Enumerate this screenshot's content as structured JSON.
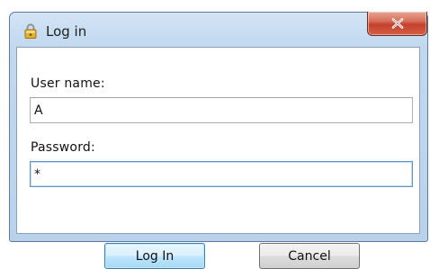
{
  "window": {
    "title": "Log in",
    "icon": "lock-icon",
    "close_glyph": "X"
  },
  "form": {
    "username_label": "User name:",
    "username_value": "A",
    "password_label": "Password:",
    "password_value": "*"
  },
  "buttons": {
    "login_label": "Log In",
    "cancel_label": "Cancel"
  },
  "colors": {
    "titlebar": "#c1d8ef",
    "close_button": "#c5412c",
    "default_button_border": "#3c7fb1"
  }
}
